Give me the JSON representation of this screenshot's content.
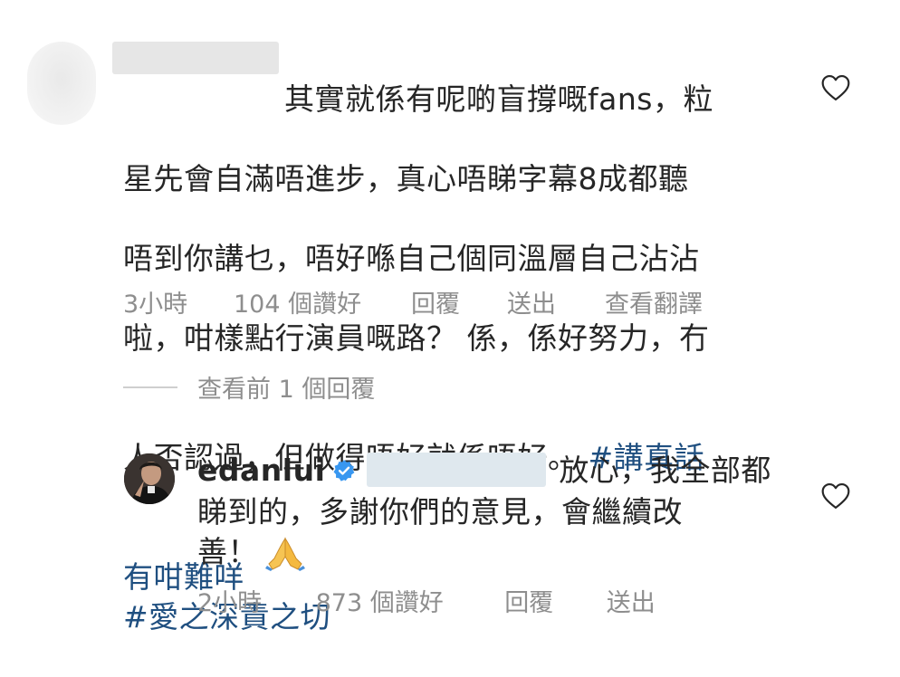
{
  "comment": {
    "text_lines": [
      "其實就係有呢啲盲撐嘅fans，粒",
      "星先會自滿唔進步，真心唔睇字幕8成都聽",
      "唔到你講乜，唔好喺自己個同溫層自己沾沾",
      "啦，咁樣點行演員嘅路？ 係，係好努力，冇",
      "人否認過，但做得唔好就係唔好。 "
    ],
    "hashtag1_part1": "#講真話",
    "hashtag1_part2": "有咁難咩",
    "hashtag2": "#愛之深責之切",
    "time": "3小時",
    "likes": "104 個讚好",
    "reply": "回覆",
    "send": "送出",
    "translate": "查看翻譯"
  },
  "view_replies": "查看前 1 個回覆",
  "reply": {
    "username": "edanlui",
    "text_line1": "放心，我全部都",
    "text_line2": "睇到的，多謝你們的意見，會繼續改",
    "text_line3": "善！",
    "time": "2小時",
    "likes": "873 個讚好",
    "reply": "回覆",
    "send": "送出"
  },
  "icons": {
    "like": "heart-outline-icon",
    "verified": "verified-badge-icon",
    "emoji": "folded-hands-emoji"
  },
  "colors": {
    "hashtag": "#1f4f80",
    "meta": "#8e8e8e",
    "verified": "#3897f0"
  }
}
